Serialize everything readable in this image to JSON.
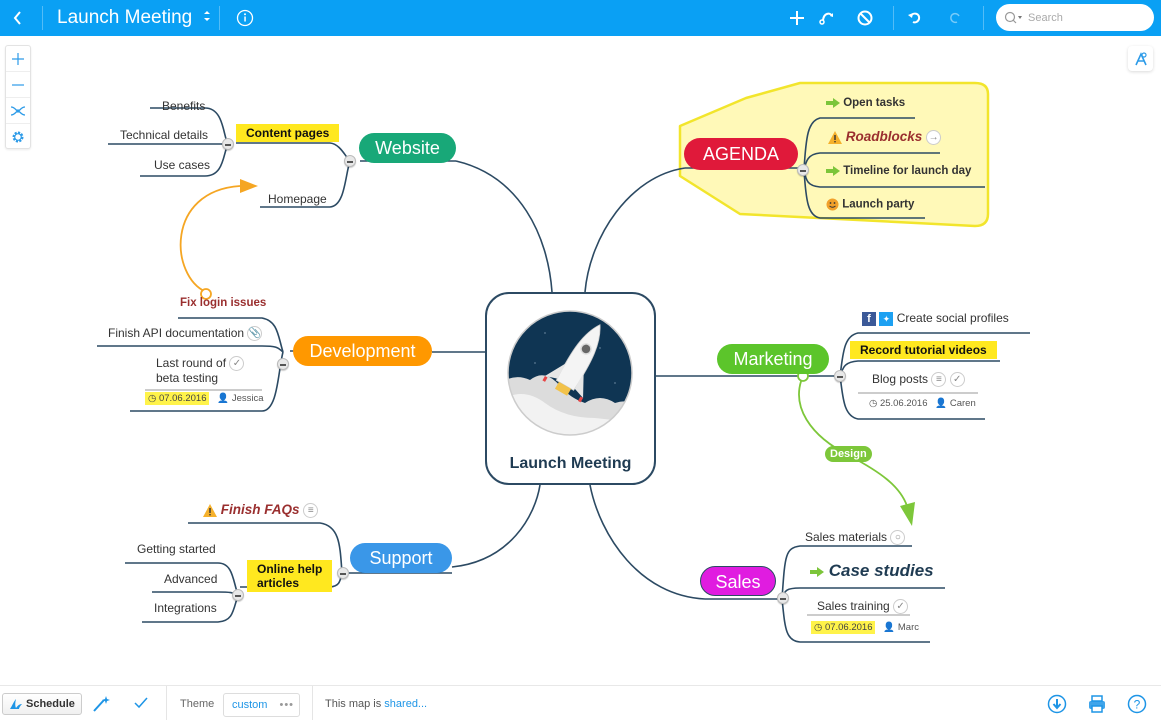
{
  "topbar": {
    "back_icon": "chevron-left-icon",
    "title": "Launch Meeting",
    "title_dropdown_icon": "up-down-caret-icon",
    "info_icon": "info-icon",
    "add_icon": "plus-icon",
    "relation_icon": "relationship-icon",
    "disable_icon": "prohibit-icon",
    "undo_icon": "undo-icon",
    "redo_icon": "redo-icon",
    "search_placeholder": "Search"
  },
  "zoom_toolbar": [
    "zoom-in-icon",
    "zoom-out-icon",
    "center-map-icon",
    "settings-gear-icon"
  ],
  "style_button_icon": "style-paint-icon",
  "center": {
    "label": "Launch Meeting",
    "image": "rocket-launch-illustration"
  },
  "branches": {
    "website": {
      "label": "Website",
      "color": "#18a878",
      "children": {
        "content_pages": "Content pages",
        "content_children": [
          "Benefits",
          "Technical details",
          "Use cases"
        ],
        "homepage": "Homepage"
      }
    },
    "agenda": {
      "label": "AGENDA",
      "color": "#e0193a",
      "boundary_color": "#fff9b8",
      "children": [
        "Open tasks",
        "Roadblocks",
        "Timeline for launch day",
        "Launch party"
      ]
    },
    "development": {
      "label": "Development",
      "color": "#ff9800",
      "children": {
        "fix_login": "Fix login issues",
        "api_docs": "Finish API documentation",
        "beta_line1": "Last round of",
        "beta_line2": "beta testing",
        "beta_date": "07.06.2016",
        "beta_assignee": "Jessica"
      }
    },
    "marketing": {
      "label": "Marketing",
      "color": "#5cc52b",
      "children": {
        "social": "Create social profiles",
        "tutorial": "Record tutorial videos",
        "blog": "Blog posts",
        "blog_date": "25.06.2016",
        "blog_assignee": "Caren"
      }
    },
    "support": {
      "label": "Support",
      "color": "#3a97e8",
      "children": {
        "faqs": "Finish FAQs",
        "help_line1": "Online help",
        "help_line2": "articles",
        "help_children": [
          "Getting started",
          "Advanced",
          "Integrations"
        ]
      }
    },
    "sales": {
      "label": "Sales",
      "color": "#e01ce0",
      "children": {
        "materials": "Sales materials",
        "case_studies": "Case studies",
        "training": "Sales training",
        "training_date": "07.06.2016",
        "training_assignee": "Marc"
      }
    }
  },
  "relationships": [
    {
      "from": "Fix login issues",
      "to": "Homepage",
      "color": "#f5a623",
      "label": ""
    },
    {
      "from": "Marketing",
      "to": "Sales materials",
      "color": "#7dc73a",
      "label": "Design"
    }
  ],
  "bottombar": {
    "schedule_label": "Schedule",
    "magic_icon": "magic-wand-icon",
    "check_icon": "checkmark-icon",
    "theme_label": "Theme",
    "theme_value": "custom",
    "theme_more": "•••",
    "share_prefix": "This map is ",
    "share_link": "shared...",
    "download_icon": "download-icon",
    "print_icon": "print-icon",
    "help_icon": "help-icon"
  }
}
